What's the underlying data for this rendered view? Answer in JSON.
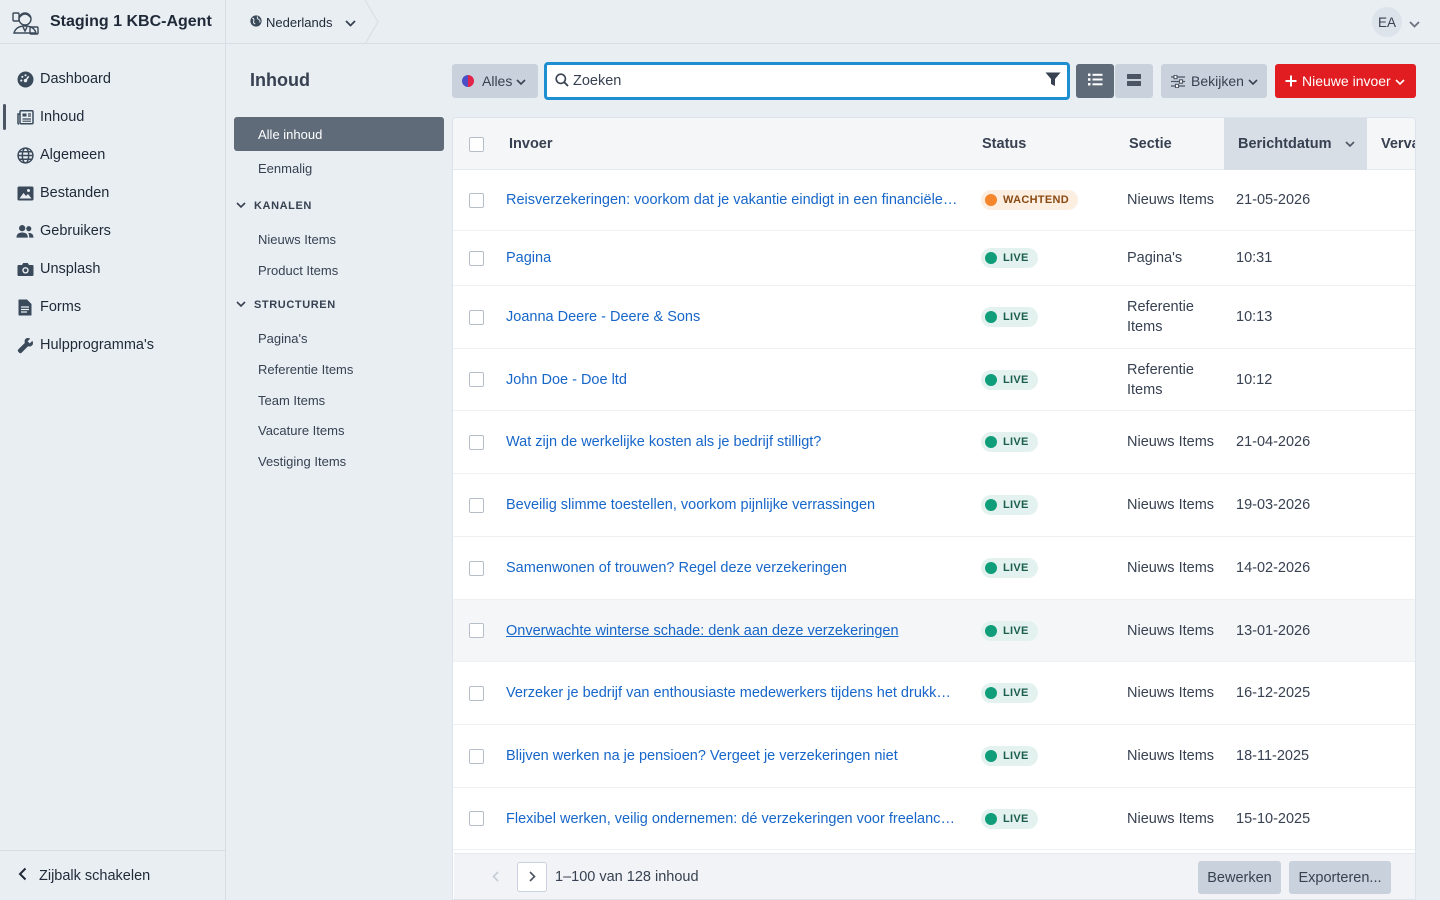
{
  "app": {
    "title": "Staging 1 KBC-Agent"
  },
  "sidebar": {
    "items": [
      {
        "label": "Dashboard",
        "icon": "dashboard-gauge-icon"
      },
      {
        "label": "Inhoud",
        "icon": "newspaper-icon",
        "active": true
      },
      {
        "label": "Algemeen",
        "icon": "globe-icon"
      },
      {
        "label": "Bestanden",
        "icon": "image-icon"
      },
      {
        "label": "Gebruikers",
        "icon": "users-icon"
      },
      {
        "label": "Unsplash",
        "icon": "camera-icon"
      },
      {
        "label": "Forms",
        "icon": "document-icon"
      },
      {
        "label": "Hulpprogramma's",
        "icon": "wrench-icon"
      }
    ],
    "toggle_label": "Zijbalk schakelen"
  },
  "topbar": {
    "language": "Nederlands",
    "user_initials": "EA"
  },
  "subnav": {
    "title": "Inhoud",
    "all_label": "Alle inhoud",
    "single_label": "Eenmalig",
    "channels_heading": "KANALEN",
    "channels": [
      "Nieuws Items",
      "Product Items"
    ],
    "structures_heading": "STRUCTUREN",
    "structures": [
      "Pagina's",
      "Referentie Items",
      "Team Items",
      "Vacature Items",
      "Vestiging Items"
    ]
  },
  "toolbar": {
    "site_filter_label": "Alles",
    "search_placeholder": "Zoeken",
    "view_label": "Bekijken",
    "new_entry_label": "Nieuwe invoer"
  },
  "table": {
    "columns": {
      "entry": "Invoer",
      "status": "Status",
      "section": "Sectie",
      "date": "Berichtdatum",
      "expiry": "Verva"
    },
    "rows": [
      {
        "title": "Reisverzekeringen: voorkom dat je vakantie eindigt in een financiële ramp",
        "status": "WACHTEND",
        "status_type": "wait",
        "section": "Nieuws Items",
        "date": "21-05-2026"
      },
      {
        "title": "Pagina",
        "status": "LIVE",
        "status_type": "live",
        "section": "Pagina's",
        "date": "10:31"
      },
      {
        "title": "Joanna Deere - Deere & Sons",
        "status": "LIVE",
        "status_type": "live",
        "section": "Referentie Items",
        "date": "10:13"
      },
      {
        "title": "John Doe - Doe ltd",
        "status": "LIVE",
        "status_type": "live",
        "section": "Referentie Items",
        "date": "10:12"
      },
      {
        "title": "Wat zijn de werkelijke kosten als je bedrijf stilligt?",
        "status": "LIVE",
        "status_type": "live",
        "section": "Nieuws Items",
        "date": "21-04-2026"
      },
      {
        "title": "Beveilig slimme toestellen, voorkom pijnlijke verrassingen",
        "status": "LIVE",
        "status_type": "live",
        "section": "Nieuws Items",
        "date": "19-03-2026"
      },
      {
        "title": "Samenwonen of trouwen? Regel deze verzekeringen",
        "status": "LIVE",
        "status_type": "live",
        "section": "Nieuws Items",
        "date": "14-02-2026"
      },
      {
        "title": "Onverwachte winterse schade: denk aan deze verzekeringen",
        "status": "LIVE",
        "status_type": "live",
        "section": "Nieuws Items",
        "date": "13-01-2026"
      },
      {
        "title": "Verzeker je bedrijf van enthousiaste medewerkers tijdens het drukke seizoen",
        "status": "LIVE",
        "status_type": "live",
        "section": "Nieuws Items",
        "date": "16-12-2025"
      },
      {
        "title": "Blijven werken na je pensioen? Vergeet je verzekeringen niet",
        "status": "LIVE",
        "status_type": "live",
        "section": "Nieuws Items",
        "date": "18-11-2025"
      },
      {
        "title": "Flexibel werken, veilig ondernemen: dé verzekeringen voor freelancers",
        "status": "LIVE",
        "status_type": "live",
        "section": "Nieuws Items",
        "date": "15-10-2025"
      }
    ]
  },
  "pagination": {
    "range_text": "1–100 van 128 inhoud",
    "edit_label": "Bewerken",
    "export_label": "Exporteren..."
  },
  "colors": {
    "accent_red": "#e11d21",
    "link_blue": "#1766c9",
    "live_green": "#0f9d7a",
    "waiting_orange": "#f5862b",
    "focus_blue": "#1d8fd1"
  }
}
